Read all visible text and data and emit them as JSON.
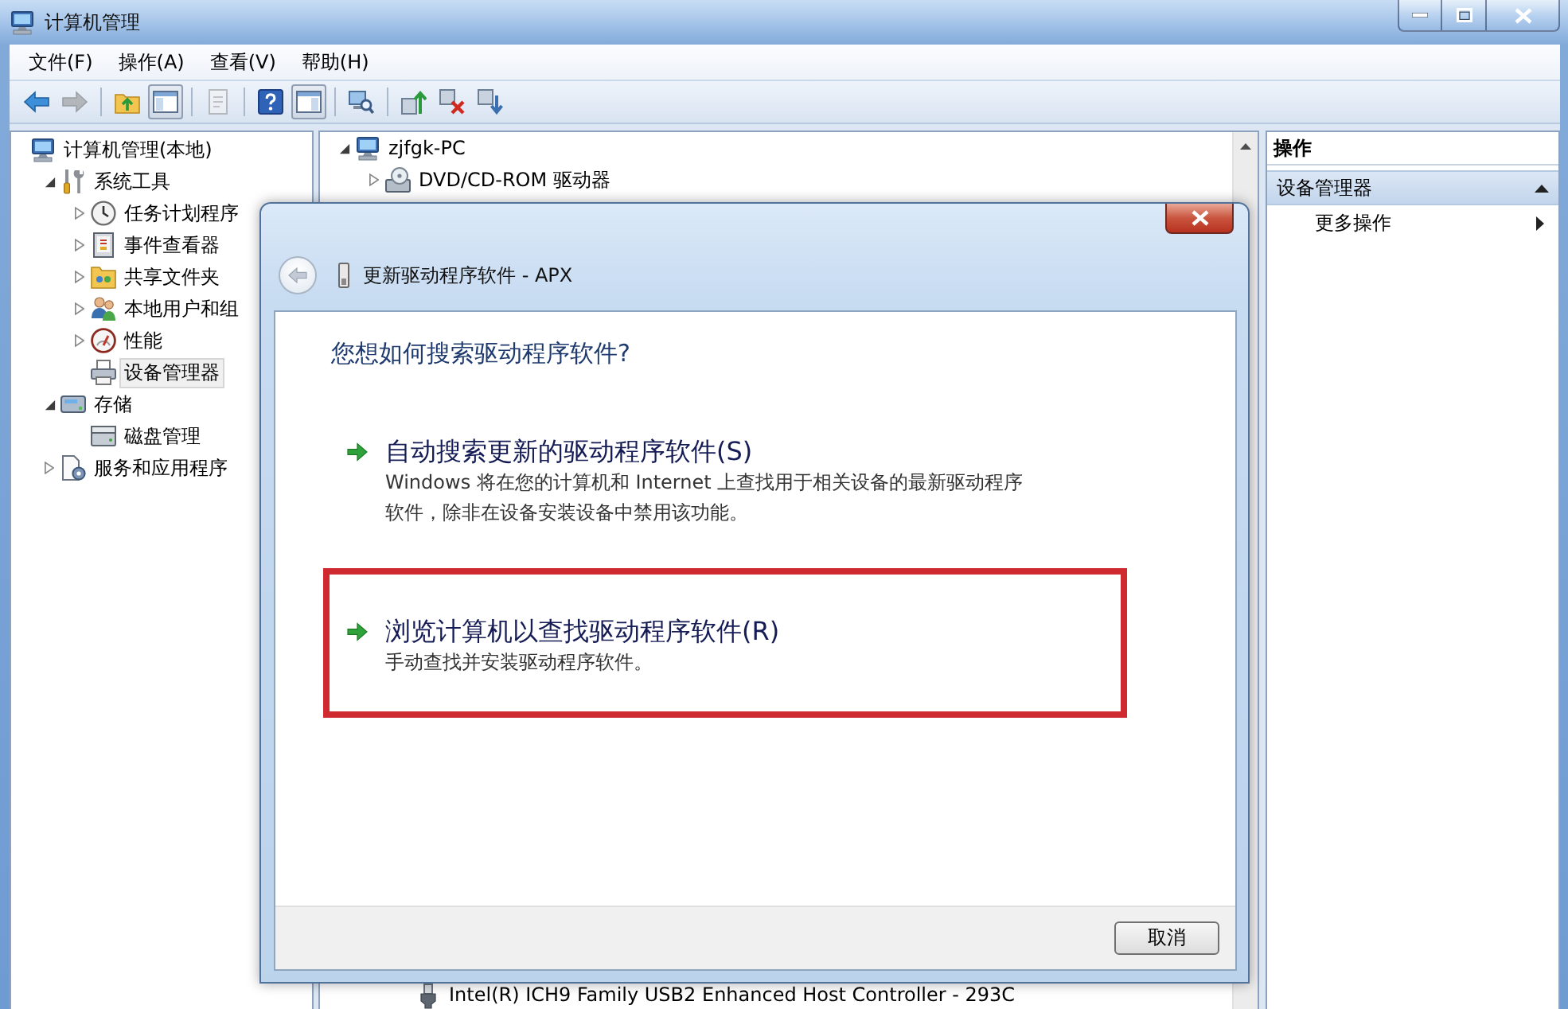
{
  "window": {
    "title": "计算机管理"
  },
  "menu": [
    "文件(F)",
    "操作(A)",
    "查看(V)",
    "帮助(H)"
  ],
  "toolbar": {
    "groups": [
      [
        {
          "disabled": false,
          "pressed": false
        },
        {
          "disabled": true,
          "pressed": false
        }
      ],
      [
        {
          "disabled": false,
          "pressed": false
        },
        {
          "disabled": false,
          "pressed": true
        }
      ],
      [
        {
          "disabled": true,
          "pressed": false
        }
      ],
      [
        {
          "disabled": false,
          "pressed": false
        },
        {
          "disabled": false,
          "pressed": true
        }
      ],
      [
        {
          "disabled": false,
          "pressed": false
        }
      ],
      [
        {
          "disabled": false,
          "pressed": false
        },
        {
          "disabled": false,
          "pressed": false
        },
        {
          "disabled": false,
          "pressed": false
        }
      ]
    ]
  },
  "console_tree": {
    "items": [
      {
        "label": "计算机管理(本地)",
        "kind": "leaf",
        "selected": false,
        "children": [
          {
            "label": "系统工具",
            "kind": "branch",
            "expanded": true,
            "selected": false,
            "children": [
              {
                "label": "任务计划程序",
                "kind": "branch",
                "expanded": false,
                "selected": false
              },
              {
                "label": "事件查看器",
                "kind": "branch",
                "expanded": false,
                "selected": false
              },
              {
                "label": "共享文件夹",
                "kind": "branch",
                "expanded": false,
                "selected": false
              },
              {
                "label": "本地用户和组",
                "kind": "branch",
                "expanded": false,
                "selected": false
              },
              {
                "label": "性能",
                "kind": "branch",
                "expanded": false,
                "selected": false
              },
              {
                "label": "设备管理器",
                "kind": "leaf",
                "selected": true
              }
            ]
          },
          {
            "label": "存储",
            "kind": "branch",
            "expanded": true,
            "selected": false,
            "children": [
              {
                "label": "磁盘管理",
                "kind": "leaf",
                "selected": false
              }
            ]
          },
          {
            "label": "服务和应用程序",
            "kind": "branch",
            "expanded": false,
            "selected": false
          }
        ]
      }
    ]
  },
  "device_tree": {
    "items": [
      {
        "label": "zjfgk-PC",
        "kind": "branch",
        "expanded": true,
        "children": [
          {
            "label": "DVD/CD-ROM 驱动器",
            "kind": "branch",
            "expanded": false
          },
          {
            "children": [
              {
                "label": "Intel(R) ICH9 Family USB2 Enhanced Host Controller - 293C",
                "kind": "leaf"
              }
            ]
          }
        ]
      }
    ]
  },
  "actions": {
    "title": "操作",
    "sections": [
      {
        "label": "设备管理器",
        "expanded": true,
        "items": [
          "更多操作"
        ]
      }
    ]
  },
  "dialog": {
    "title": "更新驱动程序软件 - APX",
    "back_button": {
      "disabled": true
    },
    "heading": "您想如何搜索驱动程序软件?",
    "options": [
      {
        "title": "自动搜索更新的驱动程序软件(S)",
        "description": "Windows 将在您的计算机和 Internet 上查找用于相关设备的最新驱动程序软件，除非在设备安装设备中禁用该功能。",
        "highlighted": false
      },
      {
        "title": "浏览计算机以查找驱动程序软件(R)",
        "description": "手动查找并安装驱动程序软件。",
        "highlighted": true
      }
    ],
    "buttons": [
      "取消"
    ]
  }
}
